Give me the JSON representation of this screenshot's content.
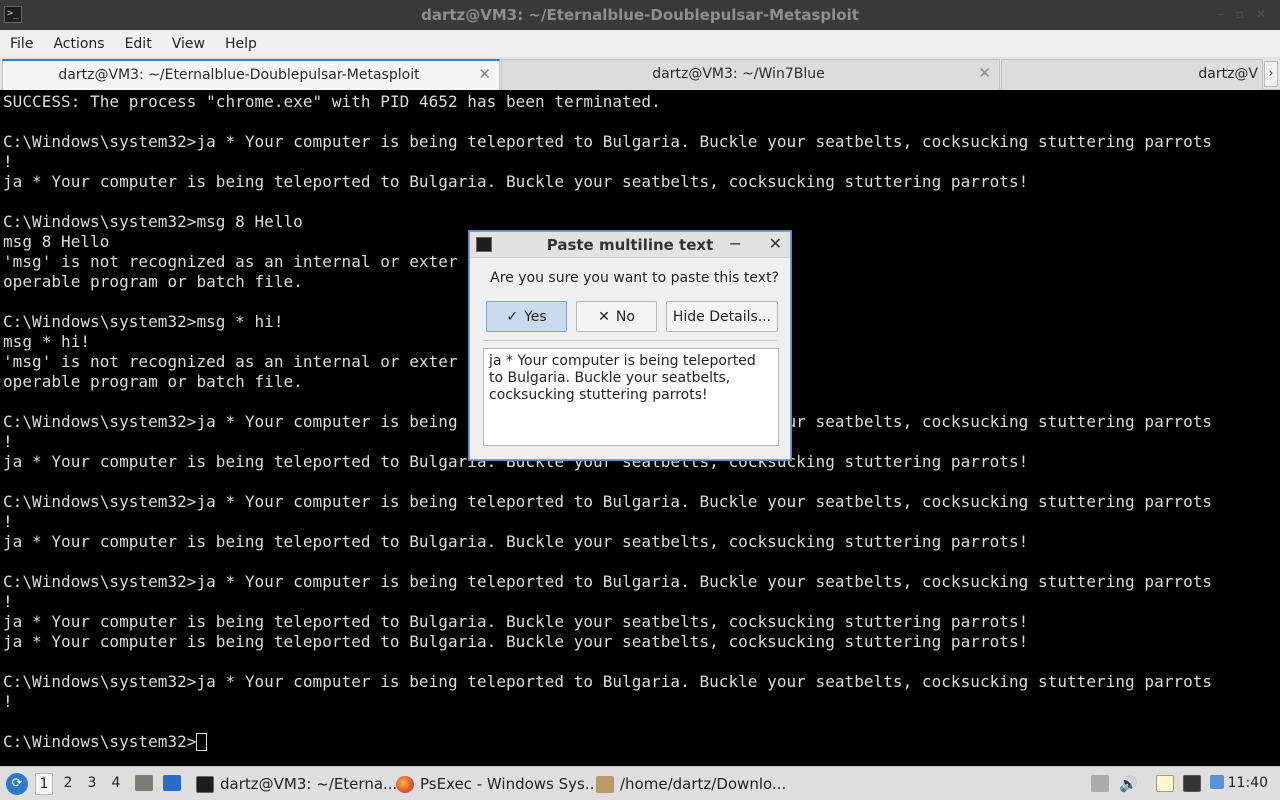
{
  "window": {
    "title": "dartz@VM3: ~/Eternalblue-Doublepulsar-Metasploit"
  },
  "menubar": {
    "items": [
      "File",
      "Actions",
      "Edit",
      "View",
      "Help"
    ]
  },
  "tabs": [
    {
      "label": "dartz@VM3: ~/Eternalblue-Doublepulsar-Metasploit",
      "active": true
    },
    {
      "label": "dartz@VM3: ~/Win7Blue",
      "active": false
    },
    {
      "label": "dartz@V",
      "active": false
    }
  ],
  "terminal": {
    "lines": [
      "SUCCESS: The process \"chrome.exe\" with PID 4652 has been terminated.",
      "",
      "C:\\Windows\\system32>ja * Your computer is being teleported to Bulgaria. Buckle your seatbelts, cocksucking stuttering parrots",
      "!",
      "ja * Your computer is being teleported to Bulgaria. Buckle your seatbelts, cocksucking stuttering parrots!",
      "",
      "C:\\Windows\\system32>msg 8 Hello",
      "msg 8 Hello",
      "'msg' is not recognized as an internal or exter",
      "operable program or batch file.",
      "",
      "C:\\Windows\\system32>msg * hi!",
      "msg * hi!",
      "'msg' is not recognized as an internal or exter",
      "operable program or batch file.",
      "",
      "C:\\Windows\\system32>ja * Your computer is being teleported to Bulgaria. Buckle your seatbelts, cocksucking stuttering parrots",
      "!",
      "ja * Your computer is being teleported to Bulgaria. Buckle your seatbelts, cocksucking stuttering parrots!",
      "",
      "C:\\Windows\\system32>ja * Your computer is being teleported to Bulgaria. Buckle your seatbelts, cocksucking stuttering parrots",
      "!",
      "ja * Your computer is being teleported to Bulgaria. Buckle your seatbelts, cocksucking stuttering parrots!",
      "",
      "C:\\Windows\\system32>ja * Your computer is being teleported to Bulgaria. Buckle your seatbelts, cocksucking stuttering parrots",
      "!",
      "ja * Your computer is being teleported to Bulgaria. Buckle your seatbelts, cocksucking stuttering parrots!",
      "ja * Your computer is being teleported to Bulgaria. Buckle your seatbelts, cocksucking stuttering parrots!",
      "",
      "C:\\Windows\\system32>ja * Your computer is being teleported to Bulgaria. Buckle your seatbelts, cocksucking stuttering parrots",
      "!",
      "",
      "C:\\Windows\\system32>"
    ]
  },
  "dialog": {
    "title": "Paste multiline text",
    "question": "Are you sure you want to paste this text?",
    "yes_label": "Yes",
    "no_label": "No",
    "details_label": "Hide Details...",
    "details_text": "ja * Your computer is being teleported to Bulgaria. Buckle your seatbelts, cocksucking stuttering parrots!"
  },
  "taskbar": {
    "workspaces": [
      "1",
      "2",
      "3",
      "4"
    ],
    "tasks": [
      {
        "label": "dartz@VM3: ~/Eterna...",
        "icon": "terminal-icon"
      },
      {
        "label": "PsExec - Windows Sys...",
        "icon": "firefox-icon"
      },
      {
        "label": "/home/dartz/Downlo...",
        "icon": "archive-icon"
      }
    ],
    "clock": "11:40"
  },
  "colors": {
    "terminal_bg": "#000000",
    "terminal_fg": "#dcdcdc",
    "accent": "#2a7fd4"
  }
}
